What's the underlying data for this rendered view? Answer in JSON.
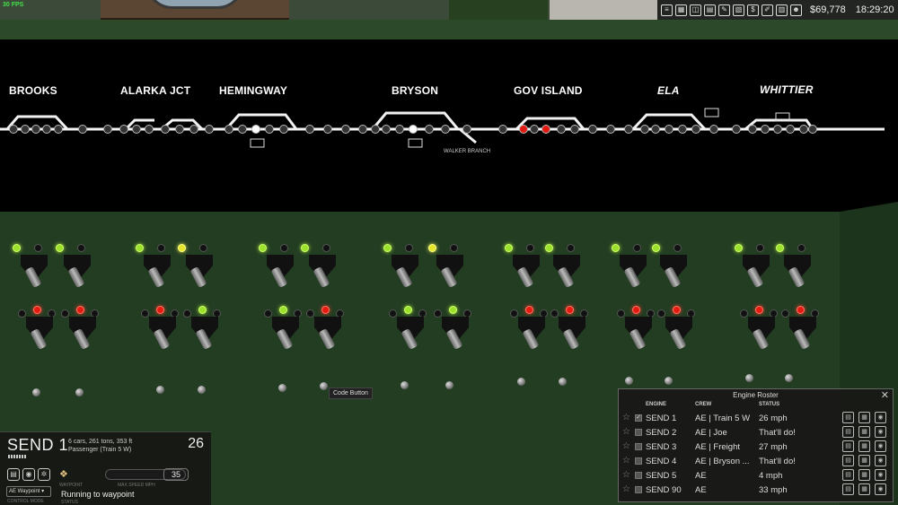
{
  "hud": {
    "fps": "30 FPS",
    "icons": [
      "list-icon",
      "building-icon",
      "car-icon",
      "car-ledger-icon",
      "notes-icon",
      "crossing-icon",
      "cash-icon",
      "pen-icon",
      "cars-icon",
      "person-icon"
    ],
    "money": "$69,778",
    "time": "18:29:20"
  },
  "board": {
    "stations": [
      {
        "name": "BROOKS",
        "italic": false
      },
      {
        "name": "ALARKA JCT",
        "italic": false
      },
      {
        "name": "HEMINGWAY",
        "italic": false
      },
      {
        "name": "BRYSON",
        "italic": false
      },
      {
        "name": "GOV ISLAND",
        "italic": false
      },
      {
        "name": "ELA",
        "italic": true
      },
      {
        "name": "WHITTIER",
        "italic": true
      }
    ],
    "branch_label": "WALKER BRANCH"
  },
  "panel": {
    "tooltip": "Code Button"
  },
  "locomotive": {
    "name": "SEND 1",
    "details_line1": "6 cars, 261 tons, 353 ft",
    "details_line2": "Passenger (Train 5 W)",
    "speed_display": "26",
    "max_speed": "35",
    "waypoint_label": "WAYPOINT",
    "max_speed_label": "MAX SPEED MPH",
    "control_mode": "AE Waypoint",
    "control_mode_label": "CONTROL MODE",
    "status": "Running to waypoint",
    "status_label": "STATUS"
  },
  "roster": {
    "title": "Engine Roster",
    "columns": [
      "ENGINE",
      "CREW",
      "STATUS"
    ],
    "rows": [
      {
        "engine": "SEND 1",
        "crew": "AE | Train 5 W",
        "status": "26 mph",
        "checked": true
      },
      {
        "engine": "SEND 2",
        "crew": "AE | Joe",
        "status": "That'll do!",
        "checked": false
      },
      {
        "engine": "SEND 3",
        "crew": "AE | Freight",
        "status": "27 mph",
        "checked": false
      },
      {
        "engine": "SEND 4",
        "crew": "AE | Bryson ...",
        "status": "That'll do!",
        "checked": false
      },
      {
        "engine": "SEND 5",
        "crew": "AE",
        "status": "4 mph",
        "checked": false
      },
      {
        "engine": "SEND 90",
        "crew": "AE",
        "status": "33 mph",
        "checked": false
      }
    ]
  }
}
